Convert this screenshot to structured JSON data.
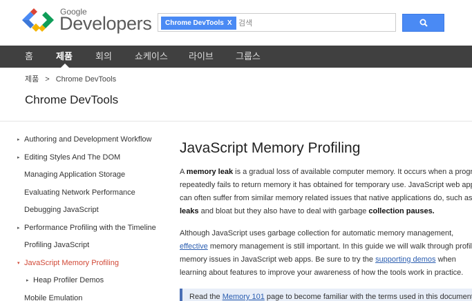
{
  "header": {
    "logo_google": "Google",
    "logo_developers": "Developers",
    "search": {
      "chip_label": "Chrome DevTools",
      "chip_close": "X",
      "placeholder": "검색",
      "button_icon": "search-icon"
    }
  },
  "nav": {
    "items": [
      "홈",
      "제품",
      "회의",
      "쇼케이스",
      "라이브",
      "그룹스"
    ],
    "active_index": 1
  },
  "breadcrumb": {
    "root": "제품",
    "separator": ">",
    "current": "Chrome DevTools"
  },
  "section_title": "Chrome DevTools",
  "sidebar": {
    "items": [
      {
        "label": "Authoring and Development Workflow",
        "arrow": "▸"
      },
      {
        "label": "Editing Styles And The DOM",
        "arrow": "▸"
      },
      {
        "label": "Managing Application Storage",
        "arrow": ""
      },
      {
        "label": "Evaluating Network Performance",
        "arrow": ""
      },
      {
        "label": "Debugging JavaScript",
        "arrow": ""
      },
      {
        "label": "Performance Profiling with the Timeline",
        "arrow": "▸"
      },
      {
        "label": "Profiling JavaScript",
        "arrow": ""
      },
      {
        "label": "JavaScript Memory Profiling",
        "arrow": "▾"
      },
      {
        "label": "Heap Profiler Demos",
        "arrow": "▸"
      },
      {
        "label": "Mobile Emulation",
        "arrow": ""
      }
    ],
    "active_index": 7
  },
  "content": {
    "title": "JavaScript Memory Profiling",
    "p1": {
      "a": "A ",
      "b1": "memory leak",
      "c": " is a gradual loss of available computer memory. It occurs when a program repeatedly fails to return memory it has obtained for temporary use. JavaScript web apps can often suffer from similar memory related issues that native applications do, such as ",
      "b2": "leaks",
      "d": " and bloat but they also have to deal with garbage ",
      "b3": "collection pauses."
    },
    "p2": {
      "a": "Although JavaScript uses garbage collection for automatic memory management, ",
      "link1": "effective",
      "b": " memory management is still important. In this guide we will walk through profiling memory issues in JavaScript web apps. Be sure to try the ",
      "link2": "supporting demos",
      "c": " when learning about features to improve your awareness of how the tools work in practice."
    },
    "note": {
      "a": "Read the ",
      "link": "Memory 101",
      "b": " page to become familiar with the terms used in this document."
    }
  },
  "colors": {
    "nav_bg": "#404040",
    "accent_blue": "#4a8af4",
    "active_red": "#d14836",
    "link": "#2a5db0"
  }
}
